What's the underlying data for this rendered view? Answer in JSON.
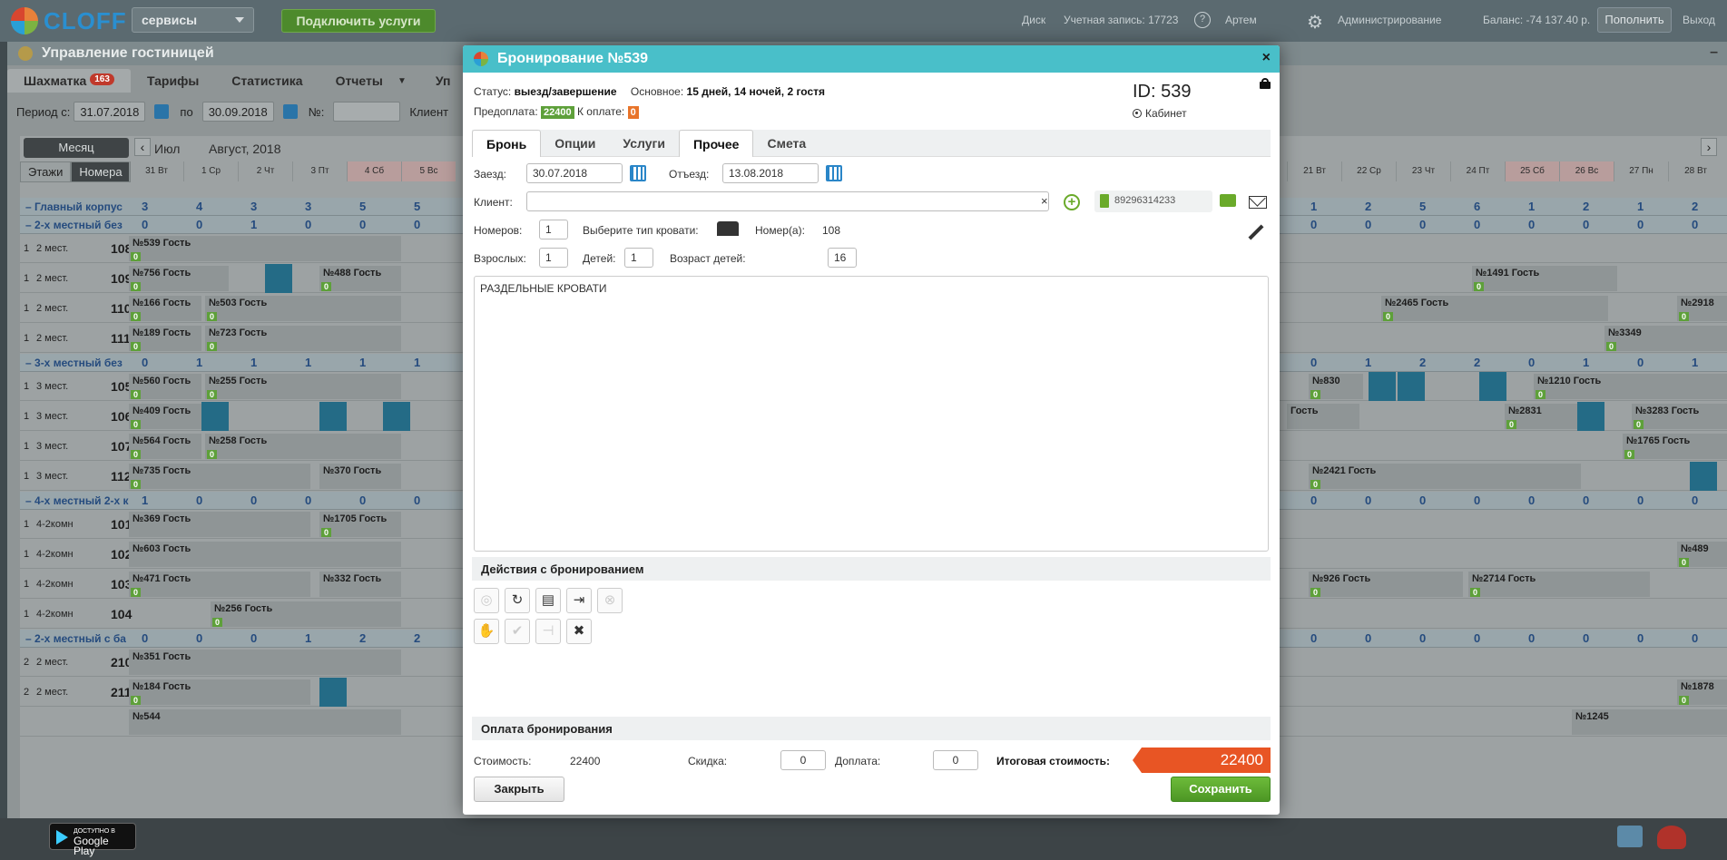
{
  "topbar": {
    "logo_text": "CLOFF",
    "services_select": "сервисы",
    "connect_button": "Подключить услуги",
    "disk_link": "Диск",
    "account_label": "Учетная запись: 17723",
    "help_icon_label": "?",
    "user_name": "Артем",
    "admin_link": "Администрирование",
    "balance": "Баланс: -74 137.40 р.",
    "topup_button": "Пополнить",
    "logout_link": "Выход"
  },
  "app": {
    "title": "Управление гостиницей",
    "tabs": [
      {
        "label": "Шахматка",
        "badge": "163"
      },
      {
        "label": "Тарифы"
      },
      {
        "label": "Статистика"
      },
      {
        "label": "Отчеты"
      },
      {
        "label": "Уп"
      }
    ],
    "filter": {
      "period_label": "Период с:",
      "period_from": "31.07.2018",
      "to_label": "по",
      "period_to": "30.09.2018",
      "num_label": "№:",
      "client_label": "Клиент"
    }
  },
  "grid": {
    "month_button": "Месяц",
    "view_floors": "Этажи",
    "view_rooms": "Номера",
    "month_prev": "Июл",
    "month_current": "Август, 2018",
    "dates_left": [
      "31 Вт",
      "1 Ср",
      "2 Чт",
      "3 Пт",
      "4 Сб",
      "5 Вс"
    ],
    "dates_right": [
      "21 Вт",
      "22 Ср",
      "23 Чт",
      "24 Пт",
      "25 Сб",
      "26 Вс",
      "27 Пн",
      "28 Вт"
    ],
    "groups": [
      {
        "name": "Главный корпус",
        "left": [
          "3",
          "4",
          "3",
          "3",
          "5",
          "5"
        ],
        "right": [
          "1",
          "2",
          "5",
          "6",
          "1",
          "2",
          "1",
          "2"
        ]
      },
      {
        "name": "2-х местный без",
        "left": [
          "0",
          "0",
          "1",
          "0",
          "0",
          "0"
        ],
        "right": [
          "0",
          "0",
          "0",
          "0",
          "0",
          "0",
          "0",
          "0"
        ]
      },
      {
        "name": "3-х местный без",
        "left": [
          "0",
          "1",
          "1",
          "1",
          "1",
          "1"
        ],
        "right": [
          "0",
          "1",
          "2",
          "2",
          "0",
          "1",
          "0",
          "1"
        ]
      },
      {
        "name": "4-х местный 2-х к",
        "left": [
          "1",
          "0",
          "0",
          "0",
          "0",
          "0"
        ],
        "right": [
          "0",
          "0",
          "0",
          "0",
          "0",
          "0",
          "0",
          "0"
        ]
      },
      {
        "name": "2-х местный с ба",
        "left": [
          "0",
          "0",
          "0",
          "1",
          "2",
          "2"
        ],
        "right": [
          "0",
          "0",
          "0",
          "0",
          "0",
          "0",
          "0",
          "0"
        ]
      }
    ],
    "rooms": [
      {
        "floor": "1",
        "type": "2 мест.",
        "num": "108",
        "bookings": [
          "№539 Гость"
        ]
      },
      {
        "floor": "1",
        "type": "2 мест.",
        "num": "109",
        "bookings": [
          "№756 Гость",
          "№488 Гость",
          "№1491 Гость"
        ]
      },
      {
        "floor": "1",
        "type": "2 мест.",
        "num": "110",
        "bookings": [
          "№166 Гость",
          "№503 Гость",
          "№2465 Гость",
          "№2918"
        ]
      },
      {
        "floor": "1",
        "type": "2 мест.",
        "num": "111",
        "bookings": [
          "№189 Гость",
          "№723 Гость",
          "№3349"
        ]
      },
      {
        "floor": "1",
        "type": "3 мест.",
        "num": "105",
        "bookings": [
          "№560 Гость",
          "№255 Гость",
          "№830",
          "№1210 Гость"
        ]
      },
      {
        "floor": "1",
        "type": "3 мест.",
        "num": "106",
        "bookings": [
          "№409 Гость",
          "Гость",
          "№2831",
          "№3283 Гость"
        ]
      },
      {
        "floor": "1",
        "type": "3 мест.",
        "num": "107",
        "bookings": [
          "№564 Гость",
          "№258 Гость",
          "№1765 Гость"
        ]
      },
      {
        "floor": "1",
        "type": "3 мест.",
        "num": "112",
        "bookings": [
          "№735 Гость",
          "№370 Гость",
          "№2421 Гость"
        ]
      },
      {
        "floor": "1",
        "type": "4-2комн",
        "num": "101",
        "bookings": [
          "№369 Гость",
          "№1705 Гость"
        ]
      },
      {
        "floor": "1",
        "type": "4-2комн",
        "num": "102",
        "bookings": [
          "№603 Гость",
          "№489"
        ]
      },
      {
        "floor": "1",
        "type": "4-2комн",
        "num": "103",
        "bookings": [
          "№471 Гость",
          "№332 Гость",
          "№926 Гость",
          "№2714 Гость"
        ]
      },
      {
        "floor": "1",
        "type": "4-2комн",
        "num": "104",
        "bookings": [
          "№256 Гость"
        ]
      },
      {
        "floor": "2",
        "type": "2 мест.",
        "num": "210",
        "bookings": [
          "№351 Гость"
        ]
      },
      {
        "floor": "2",
        "type": "2 мест.",
        "num": "211",
        "bookings": [
          "№184 Гость",
          "№1878"
        ]
      }
    ],
    "cut_row": "№544",
    "cut_row_right": "№1245",
    "zero_badge": "0"
  },
  "footer": {
    "gplay_top": "ДОСТУПНО В",
    "gplay_bottom": "Google Play"
  },
  "modal": {
    "title": "Бронирование №539",
    "status_label": "Статус:",
    "status_value": "выезд/завершение",
    "main_label": "Основное:",
    "main_value": "15 дней, 14 ночей, 2 гостя",
    "prepay_label": "Предоплата:",
    "prepay_value": "22400",
    "due_label": "К оплате:",
    "due_value": "0",
    "id_label": "ID: 539",
    "cabinet_label": "Кабинет",
    "tabs": [
      "Бронь",
      "Опции",
      "Услуги",
      "Прочее",
      "Смета"
    ],
    "checkin_label": "Заезд:",
    "checkin_value": "30.07.2018",
    "checkout_label": "Отъезд:",
    "checkout_value": "13.08.2018",
    "client_label": "Клиент:",
    "client_value": "",
    "clear_x": "×",
    "phone_value": "89296314233",
    "rooms_label": "Номеров:",
    "rooms_value": "1",
    "bed_label": "Выберите тип кровати:",
    "roomnum_label": "Номер(а):",
    "roomnum_value": "108",
    "adults_label": "Взрослых:",
    "adults_value": "1",
    "children_label": "Детей:",
    "children_value": "1",
    "child_age_label": "Возраст детей:",
    "child_age_value": "16",
    "notes": "РАЗДЕЛЬНЫЕ КРОВАТИ",
    "actions_header": "Действия с бронированием",
    "payment_header": "Оплата бронирования",
    "cost_label": "Стоимость:",
    "cost_value": "22400",
    "discount_label": "Скидка:",
    "discount_value": "0",
    "surcharge_label": "Доплата:",
    "surcharge_value": "0",
    "total_label": "Итоговая стоимость:",
    "total_value": "22400",
    "close_button": "Закрыть",
    "save_button": "Сохранить"
  }
}
